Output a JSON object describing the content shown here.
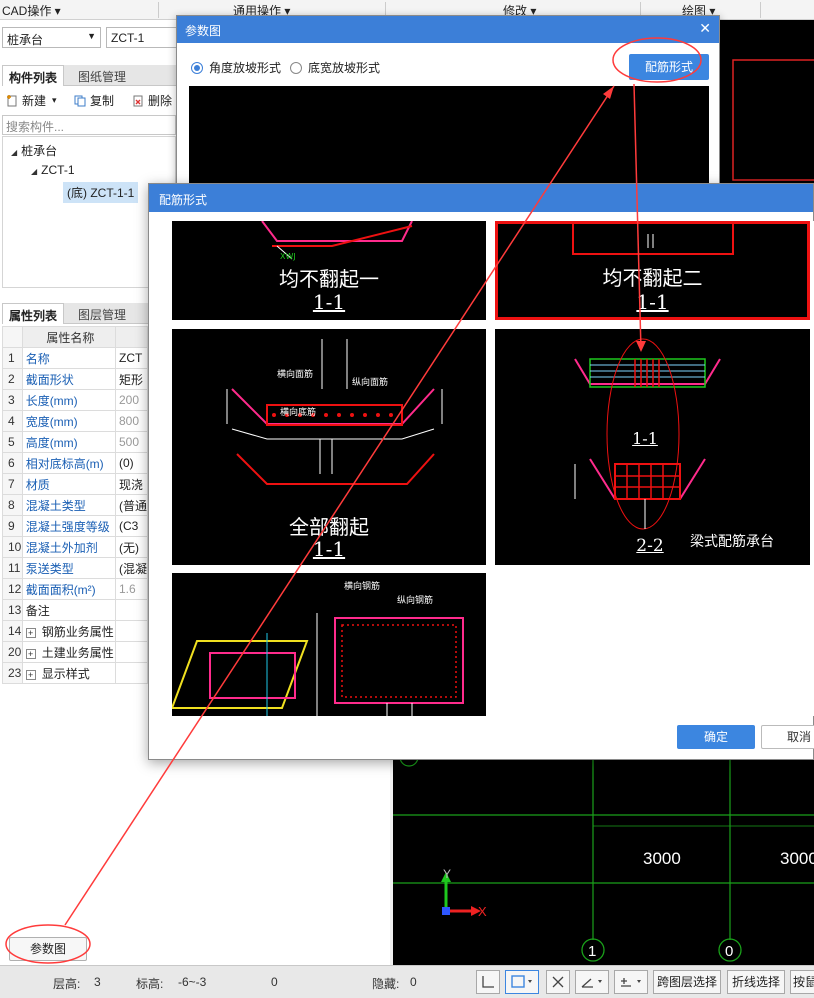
{
  "top_menu": {
    "items": [
      "CAD操作",
      "通用操作",
      "修改",
      "绘图"
    ]
  },
  "left": {
    "component_type": "桩承台",
    "component_name": "ZCT-1",
    "tabs_top": [
      "构件列表",
      "图纸管理"
    ],
    "toolbar": {
      "new": "新建",
      "copy": "复制",
      "delete": "删除"
    },
    "search_placeholder": "搜索构件...",
    "tree": {
      "root": "桩承台",
      "child": "ZCT-1",
      "leaf": "(底) ZCT-1-1"
    },
    "tabs_bottom": [
      "属性列表",
      "图层管理"
    ],
    "prop_header": "属性名称",
    "props": [
      {
        "n": "1",
        "name": "名称",
        "val": "ZCT"
      },
      {
        "n": "2",
        "name": "截面形状",
        "val": "矩形"
      },
      {
        "n": "3",
        "name": "长度(mm)",
        "val": "200"
      },
      {
        "n": "4",
        "name": "宽度(mm)",
        "val": "800"
      },
      {
        "n": "5",
        "name": "高度(mm)",
        "val": "500"
      },
      {
        "n": "6",
        "name": "相对底标高(m)",
        "val": "(0)"
      },
      {
        "n": "7",
        "name": "材质",
        "val": "现浇"
      },
      {
        "n": "8",
        "name": "混凝土类型",
        "val": "(普通"
      },
      {
        "n": "9",
        "name": "混凝土强度等级",
        "val": "(C3"
      },
      {
        "n": "10",
        "name": "混凝土外加剂",
        "val": "(无)"
      },
      {
        "n": "11",
        "name": "泵送类型",
        "val": "(混凝"
      },
      {
        "n": "12",
        "name": "截面面积(m²)",
        "val": "1.6"
      },
      {
        "n": "13",
        "name": "备注",
        "val": ""
      },
      {
        "n": "14",
        "name": "钢筋业务属性",
        "val": ""
      },
      {
        "n": "20",
        "name": "土建业务属性",
        "val": ""
      },
      {
        "n": "23",
        "name": "显示样式",
        "val": ""
      }
    ],
    "param_button": "参数图"
  },
  "cad": {
    "dim1": "3000",
    "dim2": "3000",
    "axis1": "1",
    "axis2": "0",
    "axis_x": "X",
    "axis_y": "Y"
  },
  "statusbar": {
    "floor_height_label": "层高:",
    "floor_height": "3",
    "elev_label": "标高:",
    "elev": "-6~-3",
    "zero": "0",
    "hidden_label": "隐藏:",
    "hidden": "0",
    "btn_cross": "跨图层选择",
    "btn_polyline": "折线选择",
    "btn_by": "按鼠"
  },
  "dialog_param": {
    "title": "参数图",
    "radio1": "角度放坡形式",
    "radio2": "底宽放坡形式",
    "button": "配筋形式"
  },
  "dialog_rebar": {
    "title": "配筋形式",
    "panels": {
      "p1_title": "均不翻起一",
      "p1_sec": "1-1",
      "p2_title": "均不翻起二",
      "p2_sec": "1-1",
      "p3_title": "全部翻起",
      "p3_sec": "1-1",
      "p3_lbl1": "横向面筋",
      "p3_lbl2": "纵向面筋",
      "p3_lbl3": "横向底筋",
      "p4_sec1": "1-1",
      "p4_sec2": "2-2",
      "p4_caption": "梁式配筋承台",
      "p5_lbl1": "横向钢筋",
      "p5_lbl2": "纵向钢筋"
    },
    "ok": "确定",
    "cancel": "取消"
  },
  "colors": {
    "accent": "#3c86e0",
    "annotation": "#ff3b3b"
  }
}
